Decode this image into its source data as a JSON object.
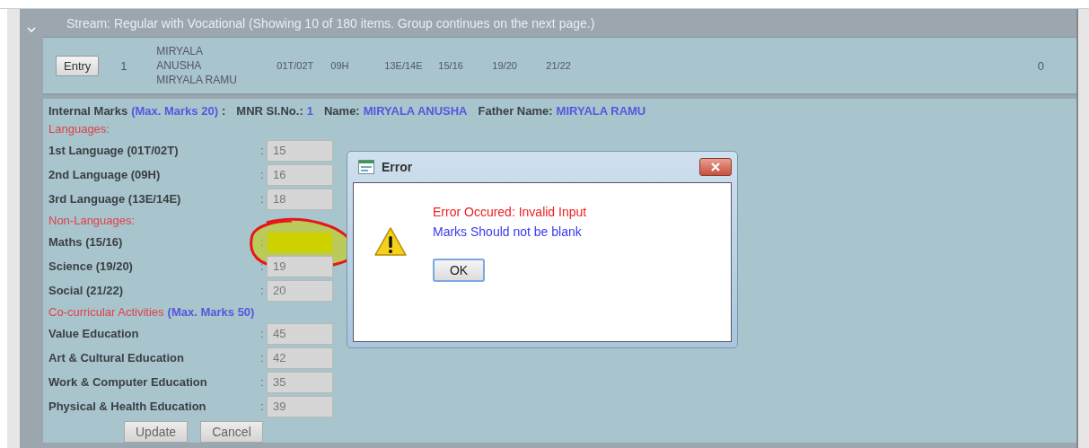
{
  "group_header": {
    "text": "Stream: Regular with Vocational (Showing 10 of 180 items. Group continues on the next page.)",
    "expanded": true
  },
  "row": {
    "entry_button": "Entry",
    "serial": "1",
    "student_name": "MIRYALA ANUSHA",
    "father_name": "MIRYALA RAMU",
    "codes": [
      "01T/02T",
      "09H",
      "13E/14E",
      "15/16",
      "19/20",
      "21/22"
    ],
    "total": "0"
  },
  "details": {
    "title": "Internal Marks",
    "max_note": "(Max. Marks 20)",
    "title_colon": ":",
    "info": [
      {
        "label": "MNR Sl.No.:",
        "value": "1"
      },
      {
        "label": "Name:",
        "value": "MIRYALA ANUSHA"
      },
      {
        "label": "Father Name:",
        "value": "MIRYALA RAMU"
      }
    ],
    "sections": [
      {
        "heading": "Languages:",
        "subjects": [
          {
            "label": "1st Language (01T/02T)",
            "value": "15",
            "annotated": false
          },
          {
            "label": "2nd Language (09H)",
            "value": "16",
            "annotated": false
          },
          {
            "label": "3rd Language (13E/14E)",
            "value": "18",
            "annotated": false
          }
        ]
      },
      {
        "heading": "Non-Languages:",
        "subjects": [
          {
            "label": "Maths (15/16)",
            "annotated": true
          },
          {
            "label": "Science (19/20)",
            "value": "19",
            "annotated": false
          },
          {
            "label": "Social (21/22)",
            "value": "20",
            "annotated": false
          }
        ]
      },
      {
        "heading": "Co-curricular Activities",
        "note": "(Max. Marks 50)",
        "subjects": [
          {
            "label": "Value Education",
            "value": "45",
            "annotated": false
          },
          {
            "label": "Art & Cultural Education",
            "value": "42",
            "annotated": false
          },
          {
            "label": "Work & Computer Education",
            "value": "35",
            "annotated": false
          },
          {
            "label": "Physical & Health Education",
            "value": "39",
            "annotated": false
          }
        ]
      }
    ],
    "colon": ":",
    "buttons": [
      "Update",
      "Cancel"
    ]
  },
  "dialog": {
    "title": "Error",
    "messages": [
      {
        "text": "Error Occured: Invalid Input",
        "kind": "error"
      },
      {
        "text": "Marks Should not be blank",
        "kind": "info"
      }
    ],
    "button": "OK"
  }
}
